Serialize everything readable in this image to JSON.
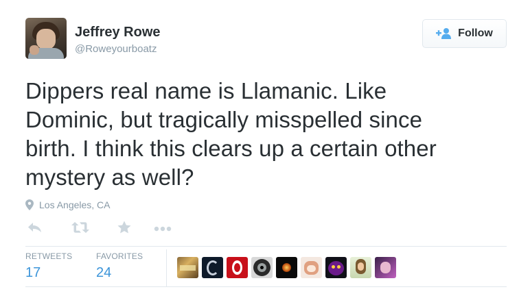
{
  "user": {
    "display_name": "Jeffrey Rowe",
    "screen_name": "@Roweyourboatz",
    "avatar_icon": "profile-photo"
  },
  "follow_button": {
    "label": "Follow",
    "icon": "add-user-icon",
    "accent": "#55acee"
  },
  "tweet": {
    "lines": [
      "Dippers real name is Llamanic. Like",
      "Dominic, but tragically misspelled since",
      "birth. I think this clears up a certain other",
      "mystery as well?"
    ]
  },
  "location": {
    "text": "Los Angeles, CA",
    "icon": "map-pin-icon"
  },
  "actions": [
    {
      "name": "reply",
      "icon": "reply-icon"
    },
    {
      "name": "retweet",
      "icon": "retweet-icon"
    },
    {
      "name": "favorite",
      "icon": "star-icon"
    },
    {
      "name": "more",
      "icon": "ellipsis-icon"
    }
  ],
  "stats": {
    "retweets_label": "RETWEETS",
    "retweets_count": "17",
    "favorites_label": "FAVORITES",
    "favorites_count": "24"
  },
  "colors": {
    "text": "#292f33",
    "muted": "#8899a6",
    "link_blue": "#3b94d9",
    "border": "#e1e8ed",
    "action_gray": "#ccd6dd"
  }
}
